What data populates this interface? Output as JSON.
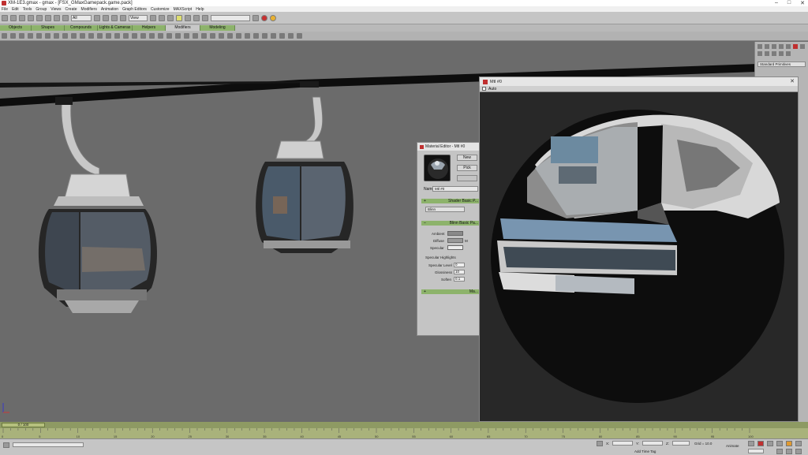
{
  "window": {
    "title": "XM-1E3.gmax - gmax - [FSX_GMaxGamepack.game.pack]"
  },
  "menu": [
    "File",
    "Edit",
    "Tools",
    "Group",
    "Views",
    "Create",
    "Modifiers",
    "Animation",
    "Graph Editors",
    "Customize",
    "MAXScript",
    "Help"
  ],
  "toolbar": {
    "selection_filter": "All",
    "view_select": "View",
    "named_selection": ""
  },
  "tabs": [
    "Objects",
    "Shapes",
    "Compounds",
    "Lights & Cameras",
    "Helpers",
    "Modifiers",
    "Modeling"
  ],
  "command_panel": {
    "category": "Standard Primitives"
  },
  "material_editor": {
    "title": "Material Editor - Mtl #0",
    "new_button": "New",
    "pick_button": "Pick",
    "name_label": "Name:",
    "name_value": "Mtl #0",
    "shader_rollout": "Shader Basic P...",
    "shader_value": "Blinn",
    "blinn_rollout": "Blinn Basic Pa...",
    "ambient_label": "Ambient",
    "diffuse_label": "Diffuse",
    "specular_label": "Specular",
    "m_label": "M",
    "highlights_label": "Specular Highlights",
    "spec_level_label": "Specular Level",
    "glossiness_label": "Glossiness",
    "soften_label": "Soften",
    "spec_level_value": "0",
    "glossiness_value": "10",
    "soften_value": "0.1",
    "maps_rollout": "Ma...",
    "colors": {
      "ambient": "#8a8a8a",
      "diffuse": "#9a9a9a",
      "specular": "#ececec"
    }
  },
  "preview_window": {
    "title": "Mtl #0",
    "auto_label": "Auto",
    "close": "✕"
  },
  "timeline": {
    "frame_display": "0 / 100",
    "ticks": [
      "0",
      "5",
      "10",
      "15",
      "20",
      "25",
      "30",
      "35",
      "40",
      "45",
      "50",
      "55",
      "60",
      "65",
      "70",
      "75",
      "80",
      "85",
      "90",
      "95",
      "100"
    ]
  },
  "status": {
    "x_label": "X:",
    "y_label": "Y:",
    "z_label": "Z:",
    "grid_label": "Grid = 10.0",
    "add_time_tag": "Add Time Tag",
    "animate_label": "Animate"
  }
}
